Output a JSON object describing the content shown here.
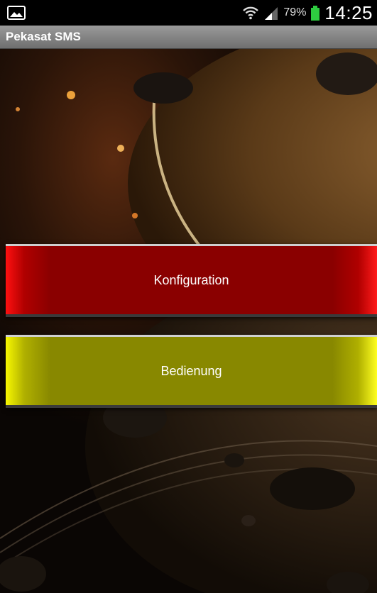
{
  "status_bar": {
    "left_icon": "image-notification-icon",
    "icons": [
      "wifi-icon",
      "signal-icon",
      "battery-icon"
    ],
    "battery_percent": "79%",
    "time": "14:25",
    "battery_color": "#2ecc40"
  },
  "action_bar": {
    "title": "Pekasat SMS"
  },
  "buttons": {
    "configuration_label": "Konfiguration",
    "configuration_color": "#8a0000",
    "operation_label": "Bedienung",
    "operation_color": "#888800"
  }
}
